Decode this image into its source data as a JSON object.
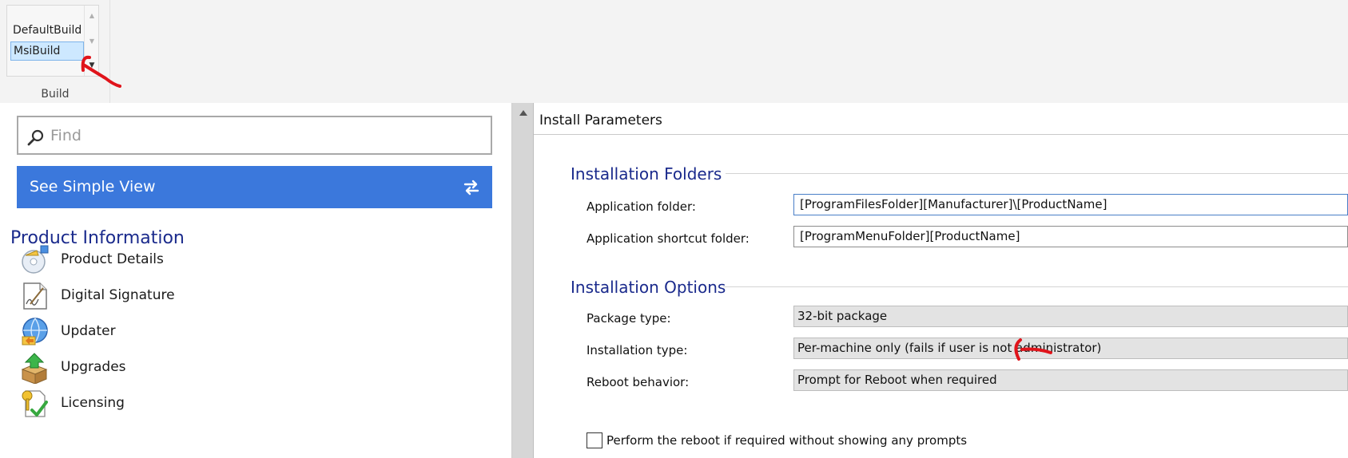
{
  "ribbon": {
    "build_configs": [
      "DefaultBuild",
      "MsiBuild"
    ],
    "selected_config": "MsiBuild",
    "group_caption": "Build"
  },
  "left_panel": {
    "find_placeholder": "Find",
    "simple_view_button": "See Simple View",
    "section_title": "Product Information",
    "nav_items": [
      {
        "label": "Product Details",
        "icon": "product-details-icon"
      },
      {
        "label": "Digital Signature",
        "icon": "digital-signature-icon"
      },
      {
        "label": "Updater",
        "icon": "updater-globe-icon"
      },
      {
        "label": "Upgrades",
        "icon": "upgrades-box-icon"
      },
      {
        "label": "Licensing",
        "icon": "licensing-key-icon"
      }
    ]
  },
  "right_panel": {
    "title": "Install Parameters",
    "installation_folders": {
      "title": "Installation Folders",
      "app_folder_label": "Application folder:",
      "app_folder_value": "[ProgramFilesFolder][Manufacturer]\\[ProductName]",
      "shortcut_folder_label": "Application shortcut folder:",
      "shortcut_folder_value": "[ProgramMenuFolder][ProductName]"
    },
    "installation_options": {
      "title": "Installation Options",
      "package_type_label": "Package type:",
      "package_type_value": "32-bit package",
      "installation_type_label": "Installation type:",
      "installation_type_value": "Per-machine only (fails if user is not administrator)",
      "reboot_behavior_label": "Reboot behavior:",
      "reboot_behavior_value": "Prompt for Reboot when required",
      "reboot_checkbox_label": "Perform the reboot if required without showing any prompts",
      "reboot_checkbox_checked": false
    }
  },
  "colors": {
    "accent_blue": "#3b78dc",
    "heading_navy": "#1a2a8c",
    "annotation_red": "#e0141b",
    "selection_blue": "#cde8ff"
  }
}
